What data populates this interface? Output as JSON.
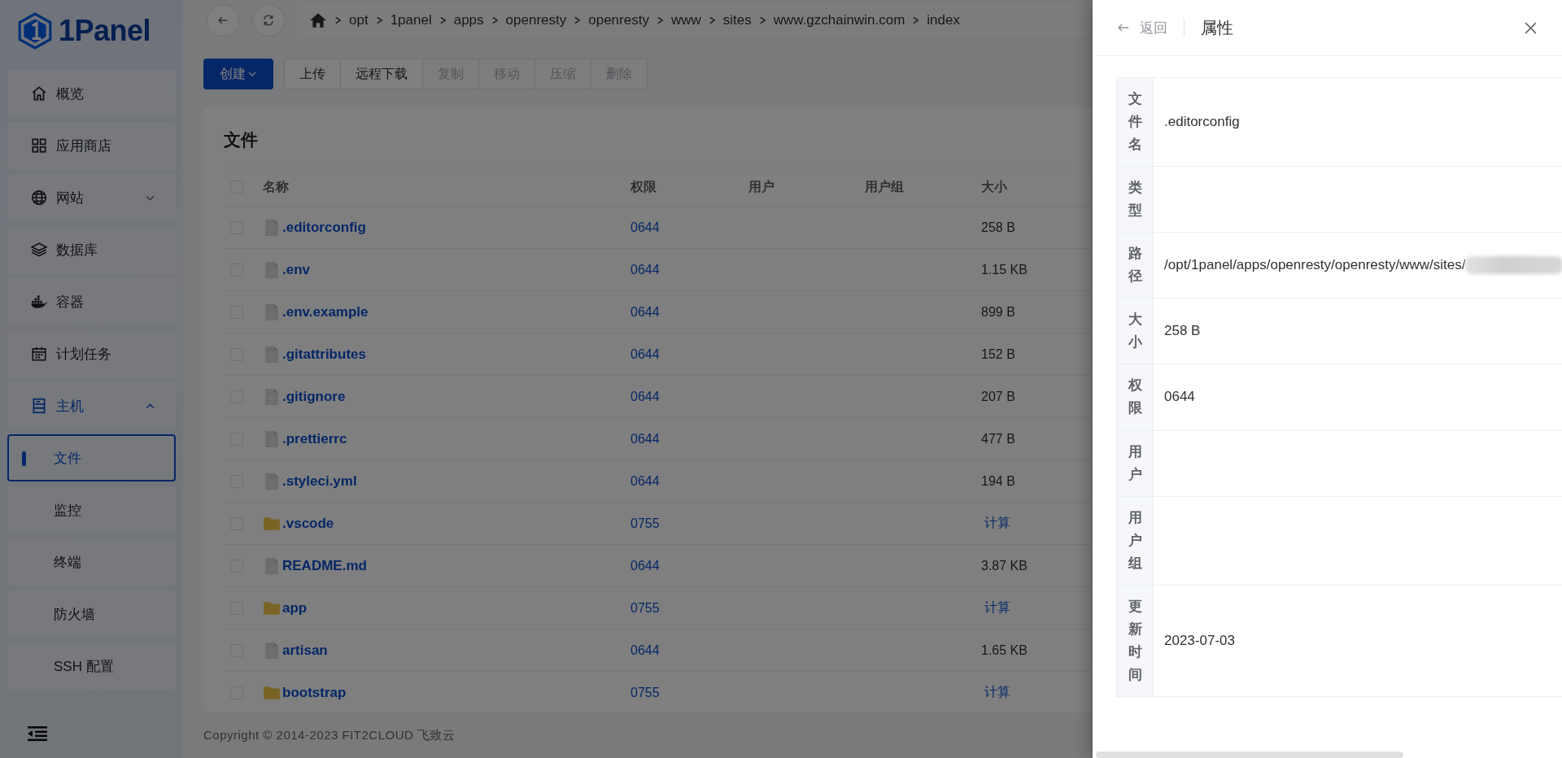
{
  "logo": {
    "text": "1Panel"
  },
  "sidebar": {
    "items": [
      {
        "label": "概览",
        "selected": false
      },
      {
        "label": "应用商店",
        "selected": false
      },
      {
        "label": "网站",
        "selected": false,
        "expanded": false
      },
      {
        "label": "数据库",
        "selected": false
      },
      {
        "label": "容器",
        "selected": false
      },
      {
        "label": "计划任务",
        "selected": false
      },
      {
        "label": "主机",
        "selected": false,
        "expanded": true,
        "children": [
          {
            "label": "文件",
            "selected": true
          },
          {
            "label": "监控",
            "selected": false
          },
          {
            "label": "终端",
            "selected": false
          },
          {
            "label": "防火墙",
            "selected": false
          },
          {
            "label": "SSH 配置",
            "selected": false
          }
        ]
      }
    ]
  },
  "breadcrumb": [
    "opt",
    "1panel",
    "apps",
    "openresty",
    "openresty",
    "www",
    "sites",
    "www.gzchainwin.com",
    "index"
  ],
  "toolbar": {
    "create": "创建",
    "buttons": [
      {
        "label": "上传",
        "disabled": false
      },
      {
        "label": "远程下载",
        "disabled": false
      },
      {
        "label": "复制",
        "disabled": true
      },
      {
        "label": "移动",
        "disabled": true
      },
      {
        "label": "压缩",
        "disabled": true
      },
      {
        "label": "删除",
        "disabled": true
      }
    ]
  },
  "card": {
    "title": "文件"
  },
  "table": {
    "select_all": false,
    "columns": [
      "名称",
      "权限",
      "用户",
      "用户组",
      "大小"
    ],
    "rows": [
      {
        "kind": "file",
        "name": ".editorconfig",
        "permission": "0644",
        "size": "258 B",
        "checked": false
      },
      {
        "kind": "file",
        "name": ".env",
        "permission": "0644",
        "size": "1.15 KB",
        "checked": false
      },
      {
        "kind": "file",
        "name": ".env.example",
        "permission": "0644",
        "size": "899 B",
        "checked": false
      },
      {
        "kind": "file",
        "name": ".gitattributes",
        "permission": "0644",
        "size": "152 B",
        "checked": false
      },
      {
        "kind": "file",
        "name": ".gitignore",
        "permission": "0644",
        "size": "207 B",
        "checked": false
      },
      {
        "kind": "file",
        "name": ".prettierrc",
        "permission": "0644",
        "size": "477 B",
        "checked": false
      },
      {
        "kind": "file",
        "name": ".styleci.yml",
        "permission": "0644",
        "size": "194 B",
        "checked": false
      },
      {
        "kind": "folder",
        "name": ".vscode",
        "permission": "0755",
        "size": "计算",
        "checked": false
      },
      {
        "kind": "file",
        "name": "README.md",
        "permission": "0644",
        "size": "3.87 KB",
        "checked": false
      },
      {
        "kind": "folder",
        "name": "app",
        "permission": "0755",
        "size": "计算",
        "checked": false
      },
      {
        "kind": "file",
        "name": "artisan",
        "permission": "0644",
        "size": "1.65 KB",
        "checked": false
      },
      {
        "kind": "folder",
        "name": "bootstrap",
        "permission": "0755",
        "size": "计算",
        "checked": false
      }
    ]
  },
  "footer": "Copyright © 2014-2023 FIT2CLOUD 飞致云",
  "drawer": {
    "back": "返回",
    "title": "属性",
    "properties": [
      {
        "label": "文件名",
        "value": ".editorconfig"
      },
      {
        "label": "类型"
      },
      {
        "label": "路径",
        "value": "/opt/1panel/apps/openresty/openresty/www/sites/",
        "redacted": true
      },
      {
        "label": "大小",
        "value": "258 B"
      },
      {
        "label": "权限",
        "value": "0644"
      },
      {
        "label": "用户"
      },
      {
        "label": "用户组"
      },
      {
        "label": "更新时间",
        "value": "2023-07-03"
      }
    ]
  }
}
